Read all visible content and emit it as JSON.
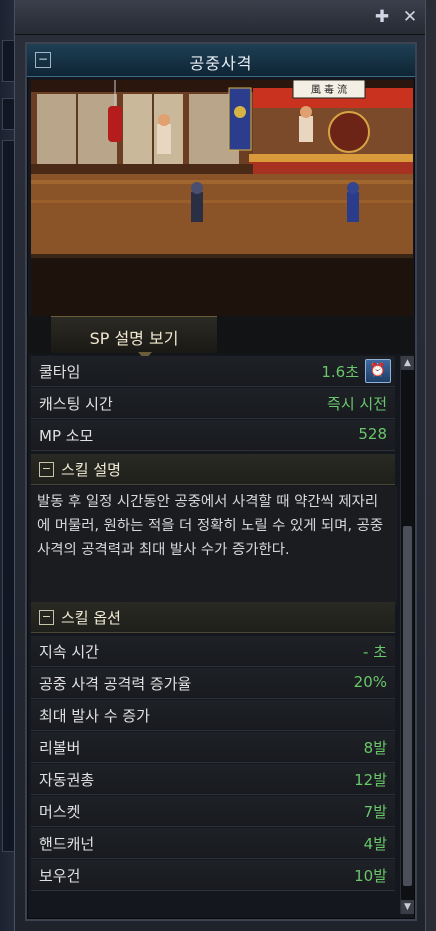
{
  "window": {
    "pin_icon": "pin-icon",
    "close_icon": "close-icon"
  },
  "skill": {
    "title": "공중사격",
    "sp_tab_label": "SP 설명 보기"
  },
  "stats": [
    {
      "label": "쿨타임",
      "value": "1.6초"
    },
    {
      "label": "캐스팅 시간",
      "value": "즉시 시전"
    },
    {
      "label": "MP 소모",
      "value": "528"
    }
  ],
  "description": {
    "header": "스킬 설명",
    "text": "발동 후 일정 시간동안 공중에서 사격할 때 약간씩 제자리에 머물러, 원하는 적을 더 정확히 노릴 수 있게 되며, 공중 사격의 공격력과 최대 발사 수가 증가한다."
  },
  "options": {
    "header": "스킬 옵션",
    "rows": [
      {
        "label": "지속 시간",
        "value": "- 초"
      },
      {
        "label": "공중 사격 공격력 증가율",
        "value": "20%"
      },
      {
        "label": "최대 발사 수 증가",
        "value": ""
      },
      {
        "label": "리볼버",
        "value": "8발"
      },
      {
        "label": "자동권총",
        "value": "12발"
      },
      {
        "label": "머스켓",
        "value": "7발"
      },
      {
        "label": "핸드캐넌",
        "value": "4발"
      },
      {
        "label": "보우건",
        "value": "10발"
      }
    ]
  },
  "scene": {
    "banner_text": "風 毒 流"
  },
  "colors": {
    "value_green": "#69c66a",
    "title_bar": "#1e3f55"
  }
}
